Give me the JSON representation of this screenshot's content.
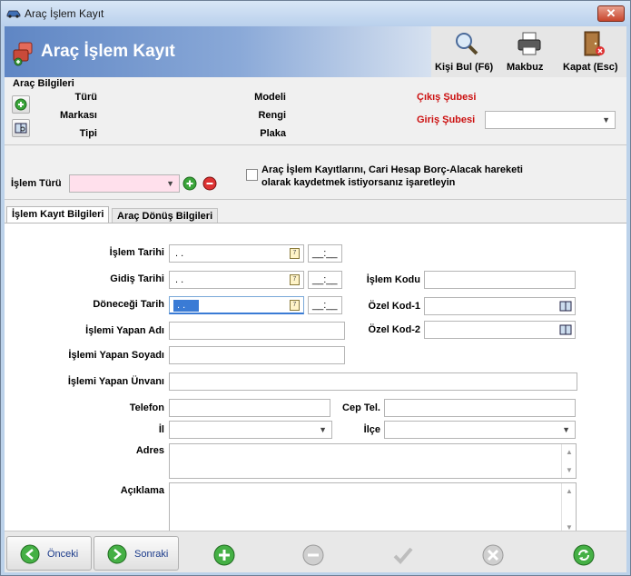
{
  "window": {
    "title": "Araç İşlem Kayıt",
    "close_label": "✕"
  },
  "header": {
    "title": "Araç İşlem Kayıt",
    "buttons": [
      {
        "label": "Kişi Bul (F6)",
        "icon": "magnifier-icon"
      },
      {
        "label": "Makbuz",
        "icon": "printer-icon"
      },
      {
        "label": "Kapat (Esc)",
        "icon": "exit-door-icon"
      }
    ]
  },
  "vehicle": {
    "section_title": "Araç Bilgileri",
    "labels": {
      "turu": "Türü",
      "markasi": "Markası",
      "tipi": "Tipi",
      "modeli": "Modeli",
      "rengi": "Rengi",
      "plaka": "Plaka",
      "cikis_subesi": "Çıkış Şubesi",
      "giris_subesi": "Giriş Şubesi"
    },
    "giris_subesi_value": ""
  },
  "process": {
    "islem_turu_label": "İşlem Türü",
    "islem_turu_value": "",
    "checkbox_text_line1": "Araç İşlem Kayıtlarını, Cari Hesap Borç-Alacak hareketi",
    "checkbox_text_line2": "olarak kaydetmek istiyorsanız işaretleyin",
    "checkbox_checked": false
  },
  "tabs": [
    {
      "label": "İşlem Kayıt Bilgileri",
      "active": true
    },
    {
      "label": "Araç Dönüş Bilgileri",
      "active": false
    }
  ],
  "form": {
    "islem_tarihi_label": "İşlem Tarihi",
    "islem_tarihi_value": ". .",
    "islem_tarihi_time": "__:__",
    "gidis_tarihi_label": "Gidiş Tarihi",
    "gidis_tarihi_value": ". .",
    "gidis_tarihi_time": "__:__",
    "donecegi_tarih_label": "Döneceği Tarih",
    "donecegi_tarih_value": ". .",
    "donecegi_tarih_time": "__:__",
    "islem_kodu_label": "İşlem Kodu",
    "ozel_kod1_label": "Özel Kod-1",
    "ozel_kod2_label": "Özel Kod-2",
    "yapan_adi_label": "İşlemi Yapan Adı",
    "yapan_soyadi_label": "İşlemi Yapan Soyadı",
    "yapan_unvani_label": "İşlemi Yapan Ünvanı",
    "telefon_label": "Telefon",
    "cep_tel_label": "Cep Tel.",
    "il_label": "İl",
    "ilce_label": "İlçe",
    "adres_label": "Adres",
    "aciklama_label": "Açıklama"
  },
  "footer": {
    "prev_label": "Önceki",
    "next_label": "Sonraki",
    "actions": [
      "add-icon",
      "remove-icon",
      "checkmark-icon",
      "cancel-icon",
      "refresh-icon"
    ]
  },
  "colors": {
    "accent_red": "#cc1111",
    "banner_blue": "#5f86c4",
    "field_pink": "#ffe0ec"
  }
}
